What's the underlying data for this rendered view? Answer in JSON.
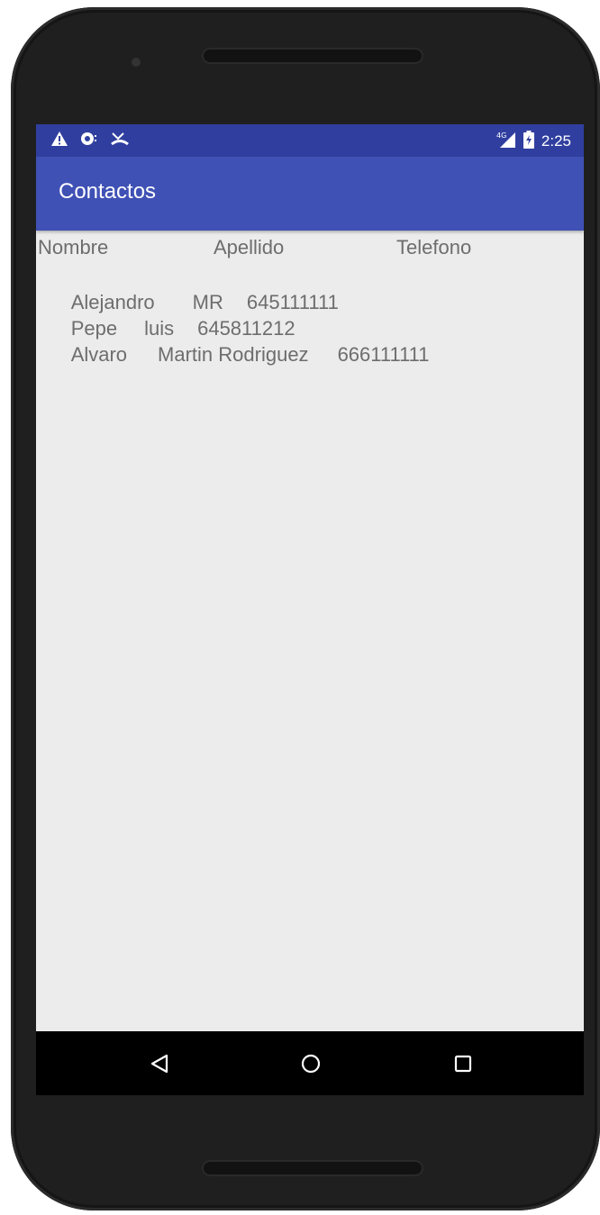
{
  "status_bar": {
    "time": "2:25",
    "network_label": "4G",
    "icons": [
      "warning-icon",
      "sync-icon",
      "missed-call-icon",
      "signal-icon",
      "battery-icon"
    ],
    "color": "#303f9f"
  },
  "app_bar": {
    "title": "Contactos",
    "color": "#3f51b5"
  },
  "table": {
    "headers": [
      "Nombre",
      "Apellido",
      "Telefono"
    ],
    "rows": [
      {
        "nombre": "Alejandro",
        "apellido": "MR",
        "telefono": "645111111"
      },
      {
        "nombre": "Pepe",
        "apellido": "luis",
        "telefono": "645811212"
      },
      {
        "nombre": "Alvaro",
        "apellido": "Martin Rodriguez",
        "telefono": "666111111"
      }
    ]
  },
  "nav_bar": {
    "icons": [
      "back-icon",
      "home-icon",
      "recents-icon"
    ]
  }
}
